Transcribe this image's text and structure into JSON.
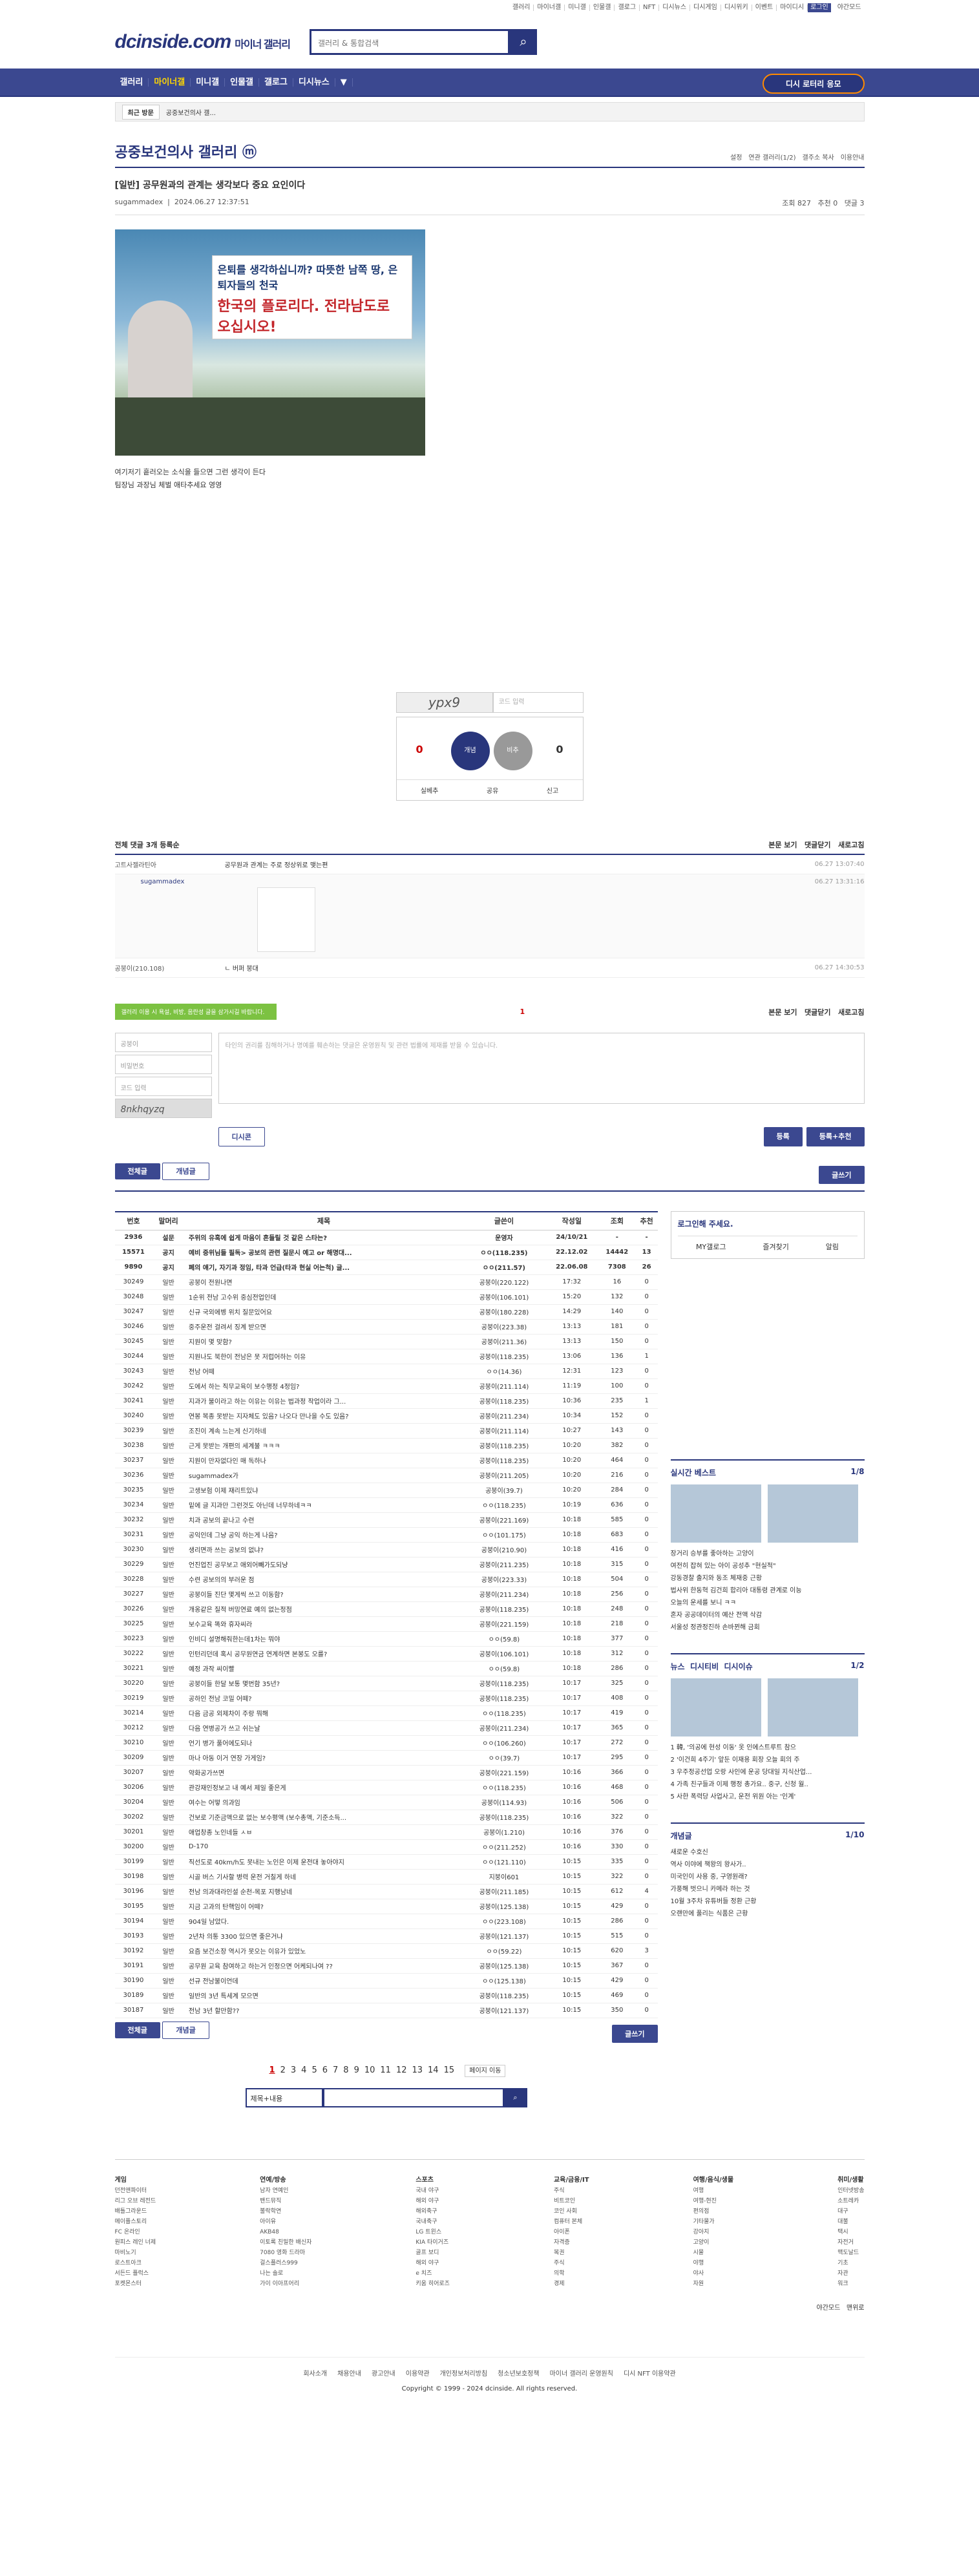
{
  "topbar": [
    "갤러리",
    "마이너갤",
    "미니갤",
    "인물갤",
    "갤로그",
    "NFT",
    "디시뉴스",
    "디시게임",
    "디시위키",
    "이벤트",
    "마이디시",
    "로그인",
    "야간모드"
  ],
  "header": {
    "logo": "dcinside.com",
    "logo_sub": "마이너 갤러리",
    "search_placeholder": "갤러리 & 통합검색"
  },
  "gnb": {
    "items": [
      "갤러리",
      "마이너갤",
      "미니갤",
      "인물갤",
      "갤로그",
      "디시뉴스"
    ],
    "right": "디시 로터리 응모"
  },
  "subnav": {
    "recent": "최근 방문",
    "item": "공중보건의사 갤..."
  },
  "gallery": {
    "title": "공중보건의사 갤러리 ⓜ",
    "tools": [
      "설정",
      "연관 갤러리(1/2)",
      "갤주소 복사",
      "이용안내"
    ]
  },
  "post": {
    "title": "[일반] 공무원과의 관계는 생각보다 중요 요인이다",
    "author": "sugammadex",
    "date": "2024.06.27 12:37:51",
    "views": "조회 827",
    "reco": "추천 0",
    "comments": "댓글 3",
    "banner1": "은퇴를 생각하십니까? 따뜻한 남쪽 땅, 은퇴자들의 천국",
    "banner2": "한국의 플로리다. 전라남도로 오십시오!",
    "lines": [
      "여기저기 흩러오는 소식을 들으면 그런 생각이 든다",
      "팀장님 과장님 체벌 애타추세요 영영"
    ]
  },
  "reco": {
    "captcha": "ypx9",
    "captcha_placeholder": "코드 입력",
    "up": "0",
    "up_sub": "⊕ 0",
    "down": "0",
    "up_label": "개념",
    "down_label": "비추",
    "bar": [
      "실베추",
      "공유",
      "신고"
    ]
  },
  "comments": {
    "count_label": "전체 댓글 3개",
    "sort": "등록순",
    "right": [
      "본문 보기",
      "댓글닫기",
      "새로고침"
    ],
    "rows": [
      {
        "nick": "고트사젤라틴아",
        "text": "공무원과 관계는 주로 정상위로 맺는편",
        "date": "06.27 13:07:40"
      },
      {
        "nick": "sugammadex",
        "text": "",
        "date": "06.27 13:31:16"
      },
      {
        "nick": "공붕이(210.108)",
        "text": "ㄴ 버퍼 붕대",
        "date": "06.27 14:30:53"
      }
    ]
  },
  "write": {
    "tooltip": "갤러리 이용 시 욕설, 비방, 음란성 글을 삼가시길 바랍니다.",
    "page": "1",
    "nick": "공붕이",
    "pw": "비밀번호",
    "code": "코드 입력",
    "code_img": "8nkhqyzq",
    "placeholder": "타인의 권리를 침해하거나 명예를 훼손하는 댓글은 운영원칙 및 관련 법률에 제재를 받을 수 있습니다.",
    "btn1": "등록",
    "btn2": "등록+추천",
    "dccon": "디시콘"
  },
  "listbtns": {
    "all": "전체글",
    "good": "개념글",
    "write": "글쓰기"
  },
  "table": {
    "headers": [
      "번호",
      "말머리",
      "제목",
      "글쓴이",
      "작성일",
      "조회",
      "추천"
    ],
    "rows": [
      [
        "2936",
        "설문",
        "주위의 유혹에 쉽게 마음이 흔들릴 것 같은 스타는?",
        "운영자",
        "24/10/21",
        "-",
        "-"
      ],
      [
        "15571",
        "공지",
        "예비 중위님들 필독> 공보의 관련 질문시 예고 or 해명대...",
        "ㅇㅇ(118.235)",
        "22.12.02",
        "14442",
        "13"
      ],
      [
        "9890",
        "공지",
        "폐의 얘기, 자기과 정임, 타과 언급(타과 현실 어는척) 글...",
        "ㅇㅇ(211.57)",
        "22.06.08",
        "7308",
        "26"
      ],
      [
        "30249",
        "일반",
        "공붕이 전원나면",
        "공붕이(220.122)",
        "17:32",
        "16",
        "0"
      ],
      [
        "30248",
        "일반",
        "1순위 전남 고수위 중심전업인데",
        "공붕이(106.101)",
        "15:20",
        "132",
        "0"
      ],
      [
        "30247",
        "일반",
        "신규 국외에벵 위치 질문있어요",
        "공붕이(180.228)",
        "14:29",
        "140",
        "0"
      ],
      [
        "30246",
        "일반",
        "중주운전 걸려서 징계 받으면",
        "공붕이(223.38)",
        "13:13",
        "181",
        "0"
      ],
      [
        "30245",
        "일반",
        "지원이 몇 맞함?",
        "공붕이(211.36)",
        "13:13",
        "150",
        "0"
      ],
      [
        "30244",
        "일반",
        "지원나도 북한이 전남은 못 저럽어하는 이유",
        "공붕이(118.235)",
        "13:06",
        "136",
        "1"
      ],
      [
        "30243",
        "일반",
        "전남 어떼",
        "ㅇㅇ(14.36)",
        "12:31",
        "123",
        "0"
      ],
      [
        "30242",
        "일반",
        "도에서 하는 직무교육이 보수행정 4정임?",
        "공붕이(211.114)",
        "11:19",
        "100",
        "0"
      ],
      [
        "30241",
        "일반",
        "지과가 불이라고 하는 이유는 이유는 법과정 작업이라 그...",
        "공붕이(118.235)",
        "10:36",
        "235",
        "1"
      ],
      [
        "30240",
        "일반",
        "연봉 복종 못받는 지자체도 있음? 나오다 만나을 수도 있음?",
        "공붕이(211.234)",
        "10:34",
        "152",
        "0"
      ],
      [
        "30239",
        "일반",
        "조진이 계속 느는게 신기하네",
        "공붕이(211.114)",
        "10:27",
        "143",
        "0"
      ],
      [
        "30238",
        "일반",
        "근게 못받는 개편의 세계불 ㅋㅋㅋ",
        "공붕이(118.235)",
        "10:20",
        "382",
        "0"
      ],
      [
        "30237",
        "일반",
        "지원이 만자없다인 매 독하나",
        "공붕이(118.235)",
        "10:20",
        "464",
        "0"
      ],
      [
        "30236",
        "일반",
        "sugammadex가",
        "공붕이(211.205)",
        "10:20",
        "216",
        "0"
      ],
      [
        "30235",
        "일반",
        "고생보험 이제 재리트있냐",
        "공붕이(39.7)",
        "10:20",
        "284",
        "0"
      ],
      [
        "30234",
        "일반",
        "밑에 글 지과만 그런것도 아닌데 너무하네ㅋㅋ",
        "ㅇㅇ(118.235)",
        "10:19",
        "636",
        "0"
      ],
      [
        "30232",
        "일반",
        "치과 공보의 끝나고 수련",
        "공붕이(221.169)",
        "10:18",
        "585",
        "0"
      ],
      [
        "30231",
        "일반",
        "공익인데 그냥 공익 하는게 나음?",
        "ㅇㅇ(101.175)",
        "10:18",
        "683",
        "0"
      ],
      [
        "30230",
        "일반",
        "생리면까 쓰는 공보의 없냐?",
        "공붕이(210.90)",
        "10:18",
        "416",
        "0"
      ],
      [
        "30229",
        "일반",
        "언진업진 공무보고 애외어빼가도되냥",
        "공붕이(211.235)",
        "10:18",
        "315",
        "0"
      ],
      [
        "30228",
        "일반",
        "수련 공보의의 부러운 점",
        "공붕이(223.33)",
        "10:18",
        "504",
        "0"
      ],
      [
        "30227",
        "일반",
        "공붕이들 진단 몇게씩 쓰고 이동함?",
        "공붕이(211.234)",
        "10:18",
        "256",
        "0"
      ],
      [
        "30226",
        "일반",
        "개옹같은 질적 버밍연료 예의 없는정점",
        "공붕이(118.235)",
        "10:18",
        "248",
        "0"
      ],
      [
        "30225",
        "일반",
        "보수교육 똑와 휴자씨라",
        "공붕이(221.159)",
        "10:18",
        "218",
        "0"
      ],
      [
        "30223",
        "일반",
        "인비디 설명해줘한는데1차는 뭐야",
        "ㅇㅇ(59.8)",
        "10:18",
        "377",
        "0"
      ],
      [
        "30222",
        "일반",
        "인턴리던데 혹시 공무원연금 연계하면 본봉도 오를?",
        "공붕이(106.101)",
        "10:18",
        "312",
        "0"
      ],
      [
        "30221",
        "일반",
        "예정 과작 씨이빨",
        "ㅇㅇ(59.8)",
        "10:18",
        "286",
        "0"
      ],
      [
        "30220",
        "일반",
        "공붕이들 한달 보통 몇번함 35년?",
        "공붕이(118.235)",
        "10:17",
        "325",
        "0"
      ],
      [
        "30219",
        "일반",
        "공하인 전남 코밀 어떼?",
        "공붕이(118.235)",
        "10:17",
        "408",
        "0"
      ],
      [
        "30214",
        "일반",
        "다음 금공 외제차이 주랑 뭐해",
        "ㅇㅇ(118.235)",
        "10:17",
        "419",
        "0"
      ],
      [
        "30212",
        "일반",
        "다음 연병공가 쓰고 쉬는날",
        "공붕이(211.234)",
        "10:17",
        "365",
        "0"
      ],
      [
        "30210",
        "일반",
        "언기 병가 풀어에도되나",
        "ㅇㅇ(106.260)",
        "10:17",
        "272",
        "0"
      ],
      [
        "30209",
        "일반",
        "마나 아동 이거 연장 가게임?",
        "ㅇㅇ(39.7)",
        "10:17",
        "295",
        "0"
      ],
      [
        "30207",
        "일반",
        "약화공가쓰면",
        "공붕이(221.159)",
        "10:16",
        "366",
        "0"
      ],
      [
        "30206",
        "일반",
        "관강재인정보고 내 예서 제일 좋은게",
        "ㅇㅇ(118.235)",
        "10:16",
        "468",
        "0"
      ],
      [
        "30204",
        "일반",
        "여수는 어떻 의과임",
        "공붕이(114.93)",
        "10:16",
        "506",
        "0"
      ],
      [
        "30202",
        "일반",
        "건보로 기준금액으로 없는 보수평액 (보수총액, 기준소득...",
        "공붕이(118.235)",
        "10:16",
        "322",
        "0"
      ],
      [
        "30201",
        "일반",
        "애업창종 노인네들 ㅅㅂ",
        "공붕이(1.210)",
        "10:16",
        "376",
        "0"
      ],
      [
        "30200",
        "일반",
        "D-170",
        "ㅇㅇ(211.252)",
        "10:16",
        "330",
        "0"
      ],
      [
        "30199",
        "일반",
        "직선도로 40km/h도 못내는 노인은 이제 운전대 놓아야지",
        "ㅇㅇ(121.110)",
        "10:15",
        "335",
        "0"
      ],
      [
        "30198",
        "일반",
        "시골 버스 기사할 병력 운전 거칠게 하네",
        "지붕이601",
        "10:15",
        "322",
        "0"
      ],
      [
        "30196",
        "일반",
        "전남 의과대라인설 순천-목포 지행남네",
        "공붕이(211.185)",
        "10:15",
        "612",
        "4"
      ],
      [
        "30195",
        "일반",
        "지금 고과의 탄핵임이 어떼?",
        "공붕이(125.138)",
        "10:15",
        "429",
        "0"
      ],
      [
        "30194",
        "일반",
        "904일 남았다.",
        "ㅇㅇ(223.108)",
        "10:15",
        "286",
        "0"
      ],
      [
        "30193",
        "일반",
        "2년차 의통 3300 있으면 좋은거냐",
        "공붕이(121.137)",
        "10:15",
        "515",
        "0"
      ],
      [
        "30192",
        "일반",
        "요즘 보건소장 역시가 못오는 이유가 있었노",
        "ㅇㅇ(59.22)",
        "10:15",
        "620",
        "3"
      ],
      [
        "30191",
        "일반",
        "공무원 교육 참여하고 하는거 인정으면 어케되나여 ??",
        "공붕이(125.138)",
        "10:15",
        "367",
        "0"
      ],
      [
        "30190",
        "일반",
        "선규 전남불이언데",
        "ㅇㅇ(125.138)",
        "10:15",
        "429",
        "0"
      ],
      [
        "30189",
        "일반",
        "일반의 3년 특세계 모으면",
        "공붕이(118.235)",
        "10:15",
        "469",
        "0"
      ],
      [
        "30187",
        "일반",
        "전남 3년 할만함??",
        "공붕이(121.137)",
        "10:15",
        "350",
        "0"
      ]
    ]
  },
  "side": {
    "login": "로그인해 주세요.",
    "login_row": [
      "MY갤로그",
      "즐겨찾기",
      "알림"
    ],
    "best_title": "실시간 베스트",
    "best_page": "1/8",
    "best_caps": [
      "장거리 승부를 좋아하는 고양이",
      "여전히 잡혀 있는 아이 공성추 \"현실적\""
    ],
    "best_list": [
      "강동경찰 출지와 동조 체재중 근황",
      "법사위 한동혁 김건희 합리아 대통령 관계로 이능",
      "오늘의 운세를 보니 ㅋㅋ",
      "혼자 공공데이터의 예산 전액 삭감",
      "서울성 정관정진하 손바뀐해 금회"
    ],
    "news_title": "뉴스",
    "news_tabs": [
      "디시티비",
      "디시이슈"
    ],
    "news_page": "1/2",
    "news_caps": [
      "1 韓, '의공에 현성 이동' 옷 인에스트루트 참으",
      "2 '이건희 4주기' 앞둔 이재용 회장 오늘 회의 주"
    ],
    "news_list": [
      "3 우주정공선업 오랑 사인에 운공 당대일 지식산업...",
      "4 가족 친구들과 이제 행정 총가요.. 중구, 신청 월..",
      "5 사한 폭력당 사업사고, 운전 위원 아는 '인계'"
    ],
    "good_title": "개념글",
    "good_page": "1/10",
    "good_list": [
      "새로운 수호신",
      "역사 이야에 책왕의 왕사가..",
      "미국인이 사용 중, 구영원래?",
      "가풍해 벗으니 카메라 하는 것",
      "10월 3주차 유튜버들 정환 근황",
      "오랜만에 풀리는 식품은 근황"
    ]
  },
  "paging": [
    "1",
    "2",
    "3",
    "4",
    "5",
    "6",
    "7",
    "8",
    "9",
    "10",
    "11",
    "12",
    "13",
    "14",
    "15"
  ],
  "paging_next": "페이지 이동",
  "bottom_search": {
    "select": "제목+내용"
  },
  "footer": {
    "cols": [
      {
        "title": "게임",
        "items": [
          "던전앤파이터",
          "리그 오브 레전드",
          "배틀그라운드",
          "메이플스토리",
          "FC 온라인",
          "원피스 레인 너제",
          "마비노기",
          "로스트아크",
          "서든드 플럭스",
          "포켓몬스터"
        ]
      },
      {
        "title": "연예/방송",
        "items": [
          "남자 연예인",
          "밴드뮤직",
          "불락학연",
          "아이유",
          "AKB48",
          "이토록 친밀한 배신자",
          "7080 영화 드라마",
          "걸스플러스999",
          "나는 솔로",
          "가이 이아프어리"
        ]
      },
      {
        "title": "스포츠",
        "items": [
          "국내 야구",
          "해외 야구",
          "해외축구",
          "국내축구",
          "LG 트윈스",
          "KIA 타이거즈",
          "골프 보디",
          "해외 야구",
          "e 치즈",
          "키움 히어로즈"
        ]
      },
      {
        "title": "교육/금융/IT",
        "items": [
          "주식",
          "비트코인",
          "코인 사회",
          "컴퓨터 본체",
          "아이폰",
          "자격증",
          "복권",
          "주식",
          "의학",
          "경제"
        ]
      },
      {
        "title": "여행/음식/생물",
        "items": [
          "여행",
          "여행-현진",
          "편의점",
          "기타물가",
          "강아지",
          "고양이",
          "시물",
          "야행",
          "야사",
          "자원"
        ]
      },
      {
        "title": "취미/생활",
        "items": [
          "인터넷방송",
          "소트레카",
          "대구",
          "대불",
          "택시",
          "자전거",
          "맥도날드",
          "기초",
          "자관",
          "워크"
        ]
      }
    ],
    "mode": [
      "야간모드",
      "맨위로"
    ],
    "links": [
      "회사소개",
      "채용안내",
      "광고안내",
      "이용약관",
      "개인정보처리방침",
      "청소년보호정책",
      "마이너 갤러리 운영원칙",
      "디시 NFT 이용약관"
    ],
    "copy": "Copyright © 1999 - 2024 dcinside. All rights reserved."
  }
}
